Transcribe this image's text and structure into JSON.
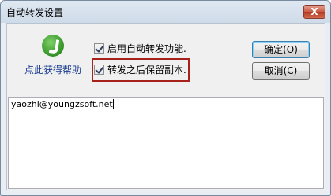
{
  "window": {
    "title": "自动转发设置",
    "close_label": "X"
  },
  "help": {
    "icon": "app-logo-icon",
    "link_label": "点此获得帮助"
  },
  "options": [
    {
      "label": "启用自动转发功能.",
      "checked": true
    },
    {
      "label": "转发之后保留副本.",
      "checked": true
    }
  ],
  "buttons": {
    "ok_label": "确定(O)",
    "cancel_label": "取消(C)"
  },
  "forward_address": {
    "value": "yaozhi@youngzsoft.net"
  },
  "colors": {
    "highlight_frame": "#a8221c",
    "link": "#1a3c8f"
  }
}
